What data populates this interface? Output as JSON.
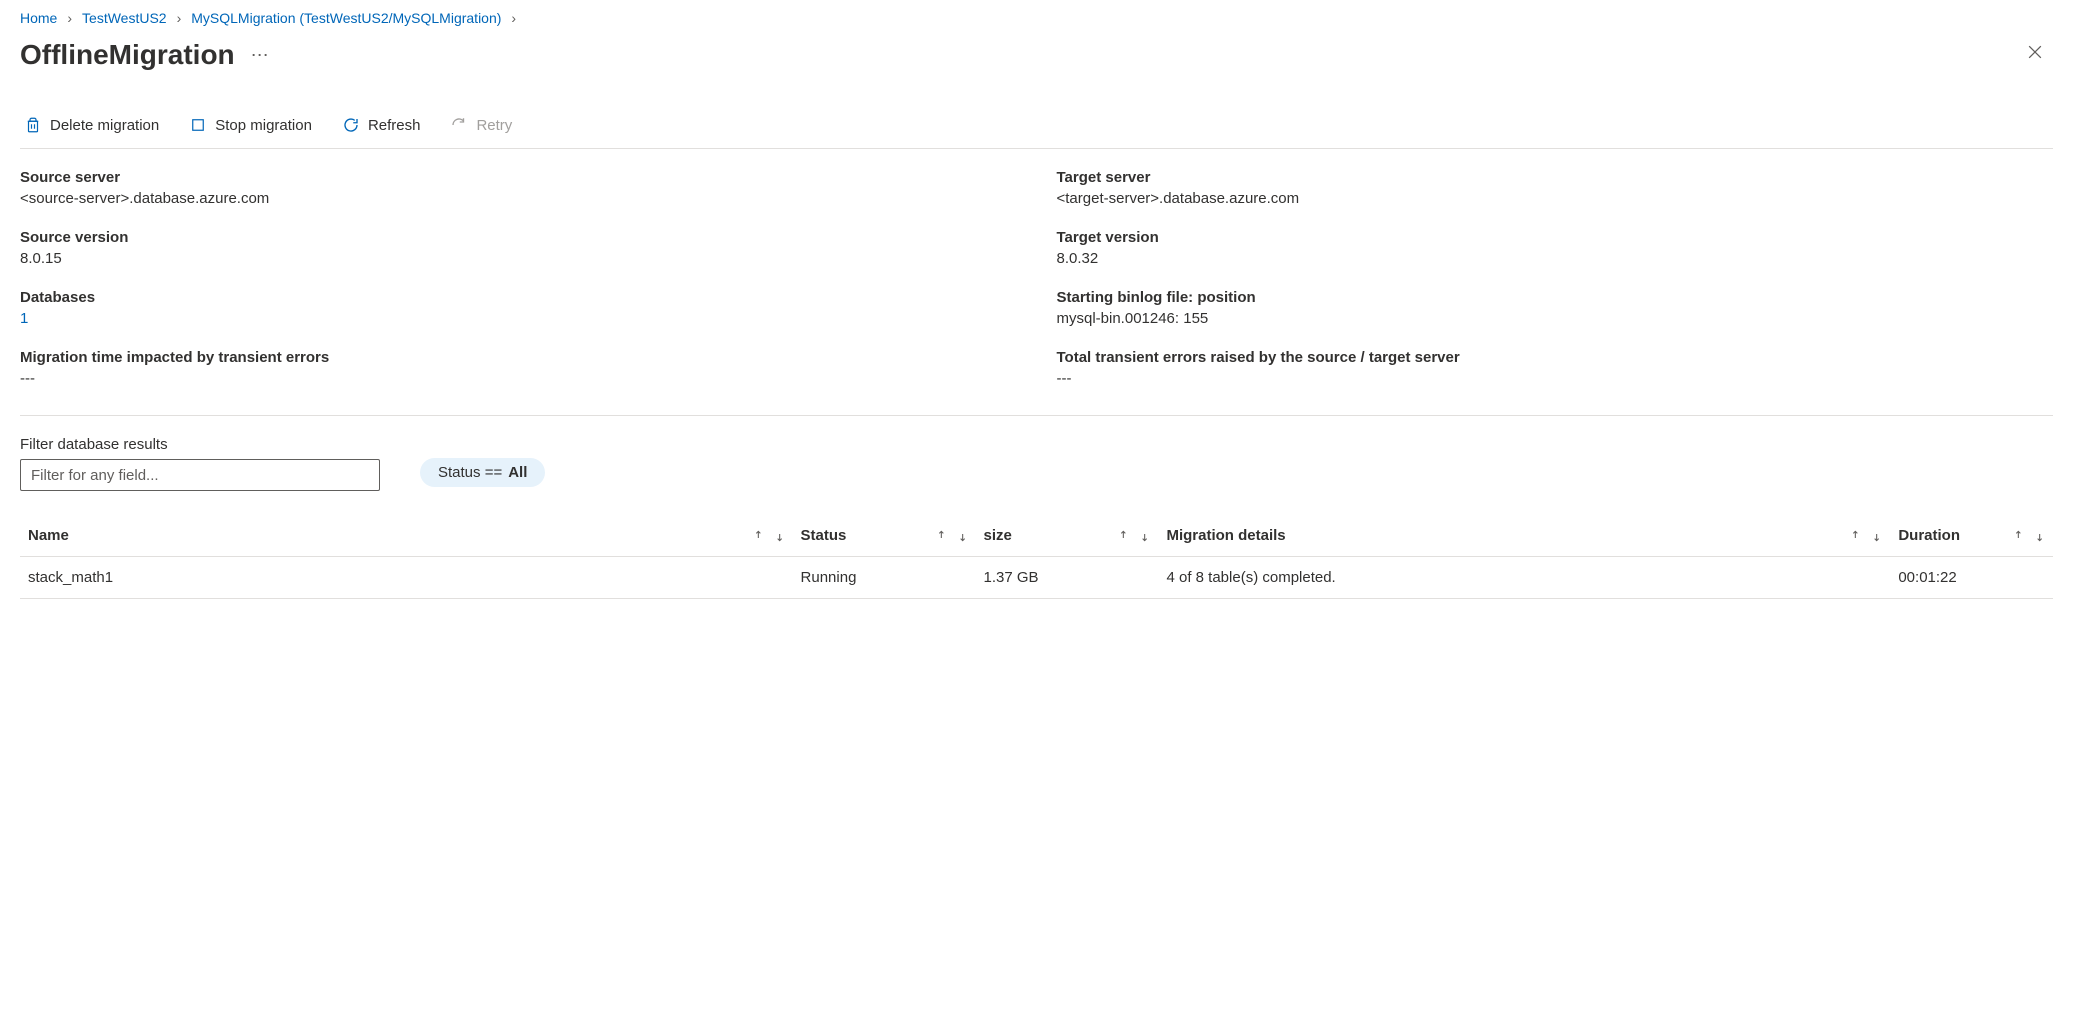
{
  "breadcrumb": {
    "items": [
      {
        "label": "Home"
      },
      {
        "label": "TestWestUS2"
      },
      {
        "label": "MySQLMigration (TestWestUS2/MySQLMigration)"
      }
    ]
  },
  "page_title": "OfflineMigration",
  "toolbar": {
    "delete_label": "Delete migration",
    "stop_label": "Stop migration",
    "refresh_label": "Refresh",
    "retry_label": "Retry"
  },
  "details": {
    "source_server": {
      "label": "Source server",
      "value": "<source-server>.database.azure.com"
    },
    "target_server": {
      "label": "Target server",
      "value": "<target-server>.database.azure.com"
    },
    "source_version": {
      "label": "Source version",
      "value": "8.0.15"
    },
    "target_version": {
      "label": "Target version",
      "value": "8.0.32"
    },
    "databases": {
      "label": "Databases",
      "value": "1"
    },
    "binlog": {
      "label": "Starting binlog file: position",
      "value": "mysql-bin.001246: 155"
    },
    "migration_time": {
      "label": "Migration time impacted by transient errors",
      "value": "---"
    },
    "transient_errors": {
      "label": "Total transient errors raised by the source / target server",
      "value": "---"
    }
  },
  "filter": {
    "label": "Filter database results",
    "placeholder": "Filter for any field...",
    "value": "",
    "status_prefix": "Status ==",
    "status_value": "All"
  },
  "table": {
    "headers": {
      "name": "Name",
      "status": "Status",
      "size": "size",
      "details": "Migration details",
      "duration": "Duration"
    },
    "rows": [
      {
        "name": "stack_math1",
        "status": "Running",
        "size": "1.37 GB",
        "details": "4 of 8 table(s) completed.",
        "duration": "00:01:22"
      }
    ]
  }
}
